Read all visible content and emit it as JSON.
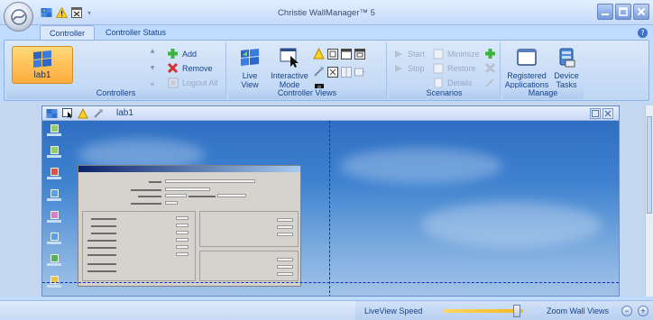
{
  "app": {
    "title": "Christie WallManager™ 5"
  },
  "tabs": [
    {
      "label": "Controller",
      "active": true
    },
    {
      "label": "Controller Status",
      "active": false
    }
  ],
  "ribbon": {
    "controllers": {
      "group_label": "Controllers",
      "selected_item": "lab1",
      "add_label": "Add",
      "remove_label": "Remove",
      "logout_all_label": "Logout All"
    },
    "controller_views": {
      "group_label": "Controller Views",
      "live_view_label": "Live View",
      "interactive_mode_label": "Interactive Mode"
    },
    "scenarios": {
      "group_label": "Scenarios",
      "start_label": "Start",
      "stop_label": "Stop",
      "minimize_label": "Minimize",
      "restore_label": "Restore",
      "details_label": "Details"
    },
    "manage": {
      "group_label": "Manage",
      "registered_apps_label": "Registered Applications",
      "device_tasks_label": "Device Tasks"
    }
  },
  "wall": {
    "title": "lab1"
  },
  "status": {
    "liveview_speed_label": "LiveView Speed",
    "liveview_speed_value": 0.92,
    "zoom_label": "Zoom Wall Views",
    "zoom_out": "−",
    "zoom_in": "+"
  },
  "colors": {
    "accent": "#15428b",
    "selected_bg": "#ffc45a",
    "wall_divider": "#0d2cbf",
    "desktop_sky": "#3f82d0"
  }
}
